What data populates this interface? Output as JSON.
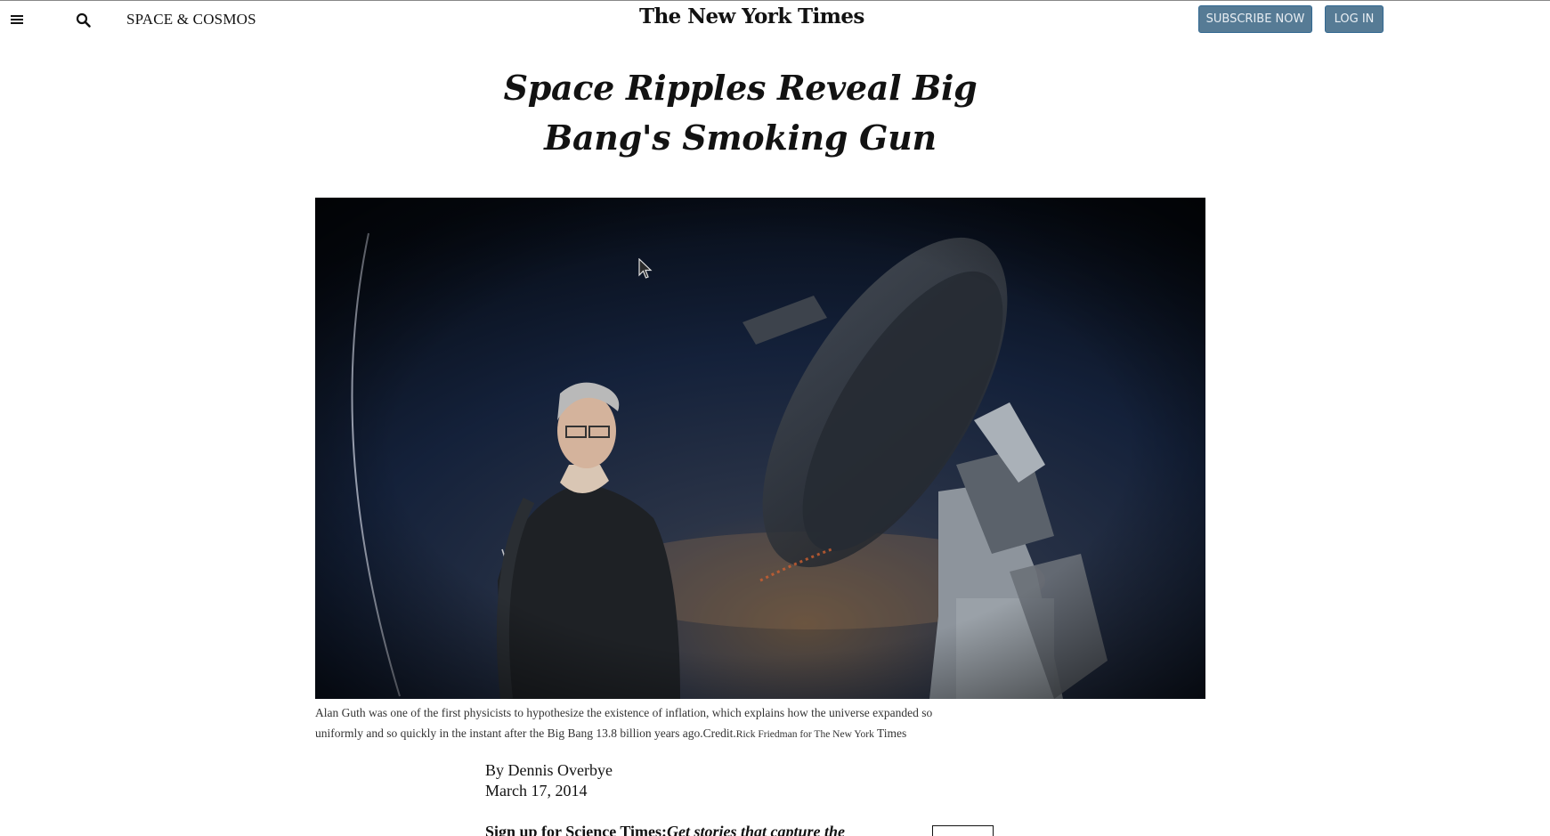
{
  "header": {
    "section": "SPACE & COSMOS",
    "logo": "The New York Times",
    "subscribe_label": "SUBSCRIBE NOW",
    "login_label": "LOG IN"
  },
  "article": {
    "headline": "Space Ripples Reveal Big Bang's Smoking Gun",
    "caption": "Alan Guth was one of the first physicists to hypothesize the existence of inflation, which explains how the universe expanded so uniformly and so quickly in the instant after the Big Bang 13.8 billion years ago.",
    "credit_prefix": "Credit.",
    "credit_name": "Rick Friedman for The New York",
    "credit_tail": " Times",
    "byline": "By Dennis Overbye",
    "date": "March 17, 2014",
    "signup_label": "Sign up for Science Times:",
    "signup_desc": "Get stories that capture the"
  },
  "icons": {
    "menu": "hamburger-menu-icon",
    "search": "magnifier-icon"
  },
  "colors": {
    "button_bg": "#567b95",
    "button_border": "#326891",
    "text": "#121212"
  }
}
